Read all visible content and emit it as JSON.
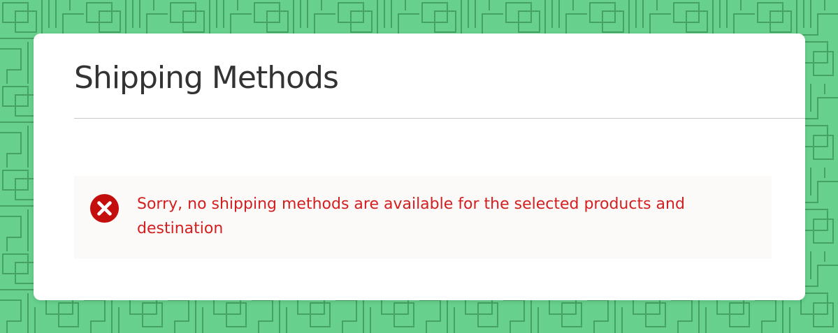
{
  "background": {
    "color": "#67d08d",
    "pattern_color": "#3f9a5c"
  },
  "panel": {
    "title": "Shipping Methods",
    "alert": {
      "icon": "error-x-circle-icon",
      "icon_color": "#c40d0d",
      "message": "Sorry, no shipping methods are available for the selected products and destination",
      "text_color": "#d31f1f"
    }
  }
}
